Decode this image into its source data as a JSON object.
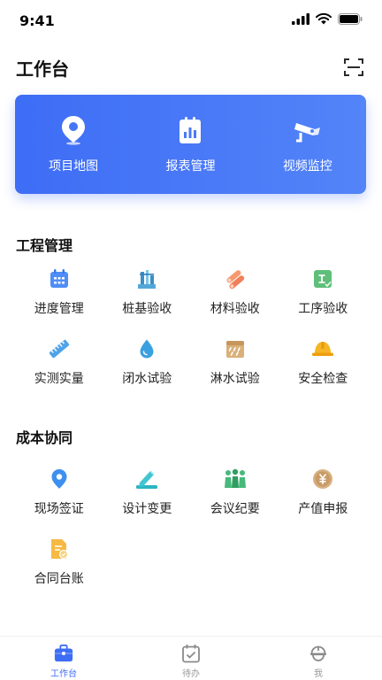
{
  "status_bar": {
    "time": "9:41"
  },
  "header": {
    "title": "工作台",
    "scan_icon": "scan-icon"
  },
  "hero": {
    "items": [
      {
        "label": "项目地图",
        "icon": "location-pin-icon"
      },
      {
        "label": "报表管理",
        "icon": "report-icon"
      },
      {
        "label": "视频监控",
        "icon": "camera-icon"
      }
    ]
  },
  "sections": {
    "engineering": {
      "title": "工程管理",
      "items": [
        {
          "label": "进度管理",
          "icon": "calendar-icon"
        },
        {
          "label": "桩基验收",
          "icon": "pile-icon"
        },
        {
          "label": "材料验收",
          "icon": "material-icon"
        },
        {
          "label": "工序验收",
          "icon": "process-icon"
        },
        {
          "label": "实测实量",
          "icon": "ruler-icon"
        },
        {
          "label": "闭水试验",
          "icon": "water-drop-icon"
        },
        {
          "label": "淋水试验",
          "icon": "rain-test-icon"
        },
        {
          "label": "安全检查",
          "icon": "helmet-icon"
        }
      ]
    },
    "cost": {
      "title": "成本协同",
      "items": [
        {
          "label": "现场签证",
          "icon": "location-icon"
        },
        {
          "label": "设计变更",
          "icon": "edit-icon"
        },
        {
          "label": "会议纪要",
          "icon": "meeting-icon"
        },
        {
          "label": "产值申报",
          "icon": "yuan-icon"
        },
        {
          "label": "合同台账",
          "icon": "contract-icon"
        }
      ]
    }
  },
  "tab_bar": {
    "tabs": [
      {
        "label": "工作台",
        "icon": "briefcase-icon",
        "active": true
      },
      {
        "label": "待办",
        "icon": "todo-calendar-icon",
        "active": false
      },
      {
        "label": "我",
        "icon": "profile-helmet-icon",
        "active": false
      }
    ]
  },
  "colors": {
    "accent": "#3e6df6",
    "tab_inactive": "#9a9a9a"
  }
}
